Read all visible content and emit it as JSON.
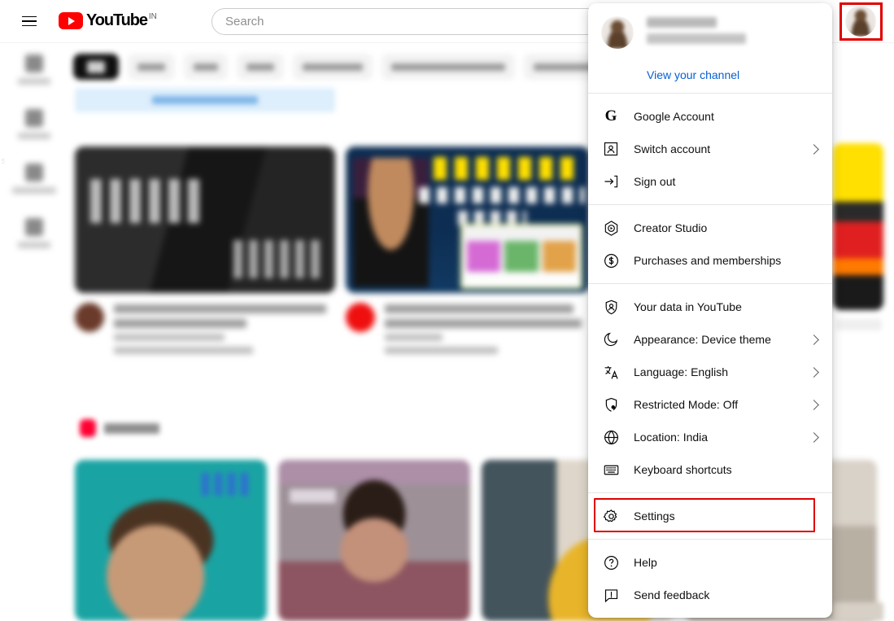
{
  "topbar": {
    "menu_icon": "hamburger-icon",
    "logo_text": "YouTube",
    "logo_country": "IN",
    "search_placeholder": "Search",
    "search_value": "",
    "avatar_label": "Account avatar"
  },
  "account_menu": {
    "profile": {
      "name": "aziz malek",
      "handle": "@azizmalek2330",
      "view_channel_label": "View your channel"
    },
    "groups": [
      {
        "items": [
          {
            "label": "Google Account",
            "icon": "google-g-icon",
            "chevron": false
          },
          {
            "label": "Switch account",
            "icon": "switch-account-icon",
            "chevron": true
          },
          {
            "label": "Sign out",
            "icon": "sign-out-icon",
            "chevron": false
          }
        ]
      },
      {
        "items": [
          {
            "label": "Creator Studio",
            "icon": "creator-studio-icon",
            "chevron": false
          },
          {
            "label": "Purchases and memberships",
            "icon": "dollar-circle-icon",
            "chevron": false
          }
        ]
      },
      {
        "items": [
          {
            "label": "Your data in YouTube",
            "icon": "shield-person-icon",
            "chevron": false
          },
          {
            "label": "Appearance: Device theme",
            "icon": "moon-icon",
            "chevron": true
          },
          {
            "label": "Language: English",
            "icon": "translate-icon",
            "chevron": true
          },
          {
            "label": "Restricted Mode: Off",
            "icon": "shield-restricted-icon",
            "chevron": true
          },
          {
            "label": "Location: India",
            "icon": "globe-icon",
            "chevron": true
          },
          {
            "label": "Keyboard shortcuts",
            "icon": "keyboard-icon",
            "chevron": false
          }
        ]
      },
      {
        "items": [
          {
            "label": "Settings",
            "icon": "gear-icon",
            "chevron": false,
            "highlighted": true
          }
        ]
      },
      {
        "items": [
          {
            "label": "Help",
            "icon": "help-circle-icon",
            "chevron": false
          },
          {
            "label": "Send feedback",
            "icon": "feedback-icon",
            "chevron": false
          }
        ]
      }
    ]
  },
  "highlights": {
    "color": "#e00000",
    "targets": [
      "avatar-button",
      "settings-menu-item"
    ]
  }
}
